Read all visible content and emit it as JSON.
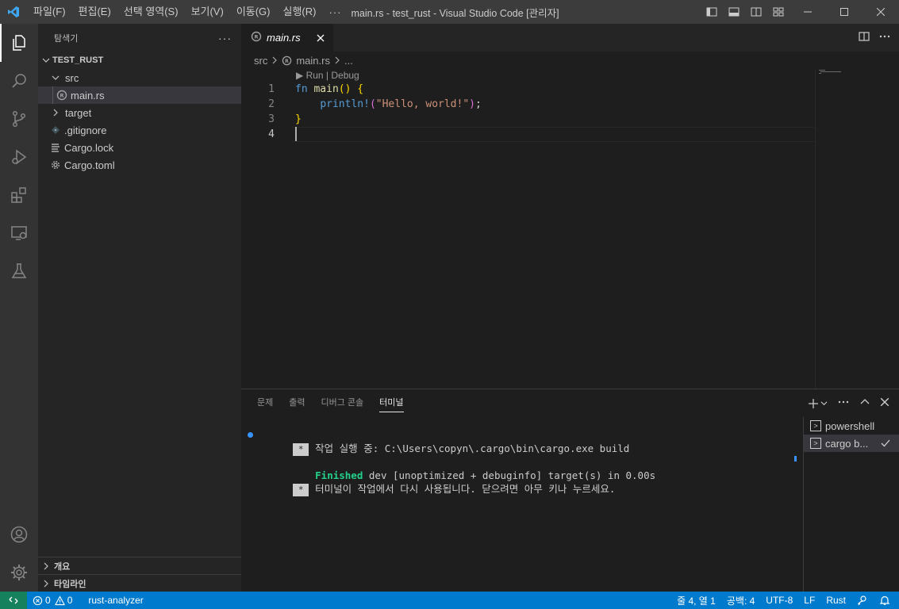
{
  "window": {
    "title": "main.rs - test_rust - Visual Studio Code [관리자]",
    "menu": [
      "파일(F)",
      "편집(E)",
      "선택 영역(S)",
      "보기(V)",
      "이동(G)",
      "실행(R)"
    ],
    "more": "···"
  },
  "activity_bar": {
    "items": [
      "explorer-icon",
      "search-icon",
      "source-control-icon",
      "run-debug-icon",
      "extensions-icon",
      "remote-explorer-icon",
      "testing-icon"
    ],
    "bottom": [
      "account-icon",
      "settings-gear-icon"
    ]
  },
  "sidebar": {
    "title": "탐색기",
    "more": "···",
    "folder": "TEST_RUST",
    "tree": [
      {
        "label": "src",
        "type": "folder-open"
      },
      {
        "label": "main.rs",
        "type": "rust-file"
      },
      {
        "label": "target",
        "type": "folder-closed"
      },
      {
        "label": ".gitignore",
        "type": "git-file"
      },
      {
        "label": "Cargo.lock",
        "type": "lines-file"
      },
      {
        "label": "Cargo.toml",
        "type": "gear-file"
      }
    ],
    "sections": [
      "개요",
      "타임라인"
    ]
  },
  "editor": {
    "tab_label": "main.rs",
    "breadcrumb": [
      "src",
      "main.rs",
      "..."
    ],
    "codelens": "▶ Run | Debug",
    "line_numbers": [
      "1",
      "2",
      "3",
      "4"
    ],
    "code": {
      "l1_kw": "fn",
      "l1_fn": "main",
      "l1_parens": "()",
      "l1_brace": "{",
      "l2_indent": "    ",
      "l2_macro": "println!",
      "l2_open": "(",
      "l2_str": "\"Hello, world!\"",
      "l2_close": ")",
      "l2_semi": ";",
      "l3_brace": "}"
    }
  },
  "panel": {
    "tabs": [
      "문제",
      "출력",
      "디버그 콘솔",
      "터미널"
    ],
    "active_tab": "터미널",
    "terminal_lines": {
      "line1_star": "*",
      "line1_text": "작업 실행 중: C:\\Users\\copyn\\.cargo\\bin\\cargo.exe build",
      "line2_green": "Finished",
      "line2_text": " dev [unoptimized + debuginfo] target(s) in 0.00s",
      "line3_star": "*",
      "line3_text": "터미널이 작업에서 다시 사용됩니다. 닫으려면 아무 키나 누르세요."
    },
    "terminals": [
      "powershell",
      "cargo b..."
    ]
  },
  "status_bar": {
    "errors": "0",
    "warnings": "0",
    "extension": "rust-analyzer",
    "position": "줄 4, 열 1",
    "spaces": "공백: 4",
    "encoding": "UTF-8",
    "eol": "LF",
    "language": "Rust"
  },
  "colors": {
    "accent": "#007acc",
    "remote": "#16825d",
    "activity_bar": "#333333",
    "sidebar": "#252526",
    "editor": "#1e1e1e"
  }
}
